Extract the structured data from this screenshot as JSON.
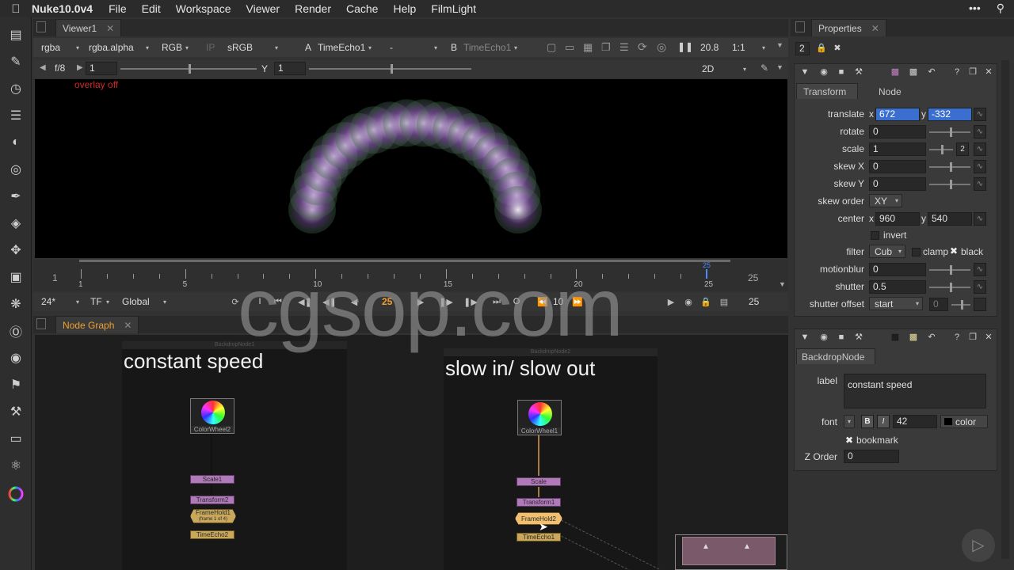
{
  "menubar": {
    "app": "Nuke10.0v4",
    "items": [
      "File",
      "Edit",
      "Workspace",
      "Viewer",
      "Render",
      "Cache",
      "Help",
      "FilmLight"
    ]
  },
  "viewer": {
    "tab": "Viewer1",
    "channels": "rgba",
    "alpha": "rgba.alpha",
    "display": "RGB",
    "ip": "IP",
    "lut": "sRGB",
    "input_a_label": "A",
    "input_a": "TimeEcho1",
    "compare": "-",
    "input_b_label": "B",
    "input_b": "TimeEcho1",
    "gain": "20.8",
    "zoom": "1:1",
    "fstop": "f/8",
    "gain_value": "1",
    "y_label": "Y",
    "gamma_value": "1",
    "view_mode": "2D",
    "overlay": "overlay off"
  },
  "timeline": {
    "start": "1",
    "end": "25",
    "ticks": [
      "1",
      "5",
      "10",
      "15",
      "20",
      "25"
    ],
    "current_marker": "25",
    "fps": "24*",
    "tf": "TF",
    "range": "Global",
    "current_frame": "25",
    "step": "10",
    "end_frame": "25",
    "in_label": "I",
    "out_label": "O"
  },
  "node_graph": {
    "tab": "Node Graph",
    "backdrop1": {
      "header": "BackdropNode1",
      "title": "constant speed"
    },
    "backdrop2": {
      "header": "BackdropNode2",
      "title": "slow in/ slow out"
    },
    "nodes_left": {
      "colorwheel": "ColorWheel2",
      "scale": "Scale1",
      "transform": "Transform2",
      "framehold": "FrameHold1",
      "framehold_sub": "(frame 1 of 4)",
      "timeecho": "TimeEcho2"
    },
    "nodes_right": {
      "colorwheel": "ColorWheel1",
      "scale": "Scale",
      "transform": "Transform1",
      "framehold": "FrameHold2",
      "timeecho": "TimeEcho1"
    }
  },
  "properties": {
    "tab": "Properties",
    "count": "2",
    "transform_panel": {
      "tabs": [
        "Transform",
        "Node"
      ],
      "translate_label": "translate",
      "x_label": "x",
      "y_label": "y",
      "translate_x": "672",
      "translate_y": "-332",
      "rotate_label": "rotate",
      "rotate": "0",
      "scale_label": "scale",
      "scale": "1",
      "scale_btn": "2",
      "skewx_label": "skew X",
      "skewx": "0",
      "skewy_label": "skew Y",
      "skewy": "0",
      "skeworder_label": "skew order",
      "skeworder": "XY",
      "center_label": "center",
      "center_x": "960",
      "center_y": "540",
      "invert": "invert",
      "filter_label": "filter",
      "filter": "Cub",
      "clamp": "clamp",
      "black": "black",
      "motionblur_label": "motionblur",
      "motionblur": "0",
      "shutter_label": "shutter",
      "shutter": "0.5",
      "shutter_offset_label": "shutter offset",
      "shutter_offset": "start",
      "shutter_offset_value": "0"
    },
    "backdrop_panel": {
      "name": "BackdropNode",
      "label_label": "label",
      "label": "constant speed",
      "font_label": "font",
      "bold": "B",
      "italic": "I",
      "font_size": "42",
      "color": "color",
      "bookmark": "bookmark",
      "zorder_label": "Z Order",
      "zorder": "0"
    }
  },
  "watermark": "cgsop.com",
  "colors": {
    "accent": "#3a6fd0",
    "active_tab": "#f0a030",
    "overlay": "#d02a2a"
  }
}
